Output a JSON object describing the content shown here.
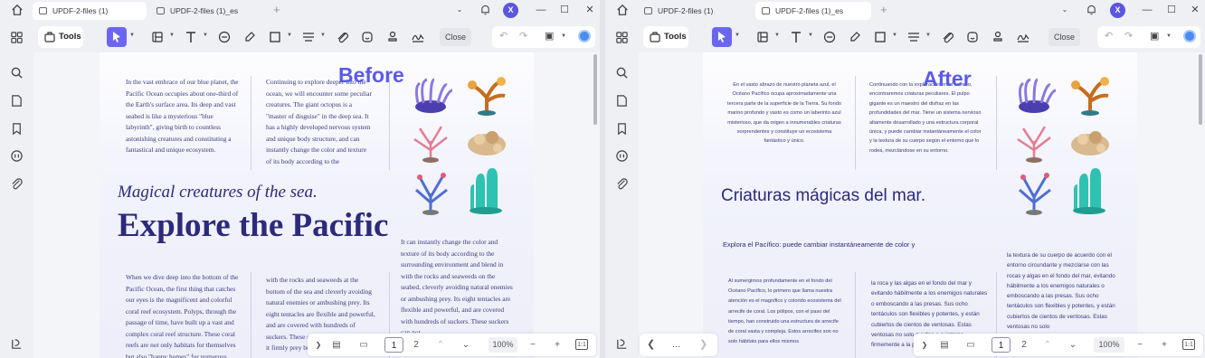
{
  "left": {
    "tabs": [
      {
        "label": "UPDF-2-files (1)"
      },
      {
        "label": "UPDF-2-files (1)_es"
      }
    ],
    "toolbar": {
      "tools_label": "Tools",
      "close_label": "Close"
    },
    "badge": "Before",
    "doc": {
      "col1": "In the vast embrace of our blue planet, the Pacific Ocean occupies about one-third of the Earth's surface area. Its deep and vast seabed is like a mysterious \"blue labyrinth\", giving birth to countless astonishing creatures and constituting a fantastical and unique ecosystem.",
      "col2": "Continuing to explore deeper into the ocean, we will encounter some peculiar creatures. The giant octopus is a \"master of disguise\" in the deep sea. It has a highly developed nervous system and unique body structure, and can instantly change the color and texture of its body according to the surrounding environment, blending is",
      "subtitle": "Magical creatures of the sea.",
      "title": "Explore the Pacific",
      "col3": "It can instantly change the color and texture of its body according to the surrounding environment and blend in with the rocks and seaweeds on the seabed, cleverly avoiding natural enemies or ambushing prey. Its eight tentacles are flexible and powerful, and are covered with hundreds of suckers. These suckers can not",
      "col4": "When we dive deep into the bottom of the Pacific Ocean, the first thing that catches our eyes is the magnificent and colorful coral reef ecosystem. Polyps, through the passage of time, have built up a vast and complex coral reef structure. These coral reefs are not only habitats for themselves but also \"happy homes\" for numerous",
      "col5": "with the rocks and seaweeds at the bottom of the sea and cleverly avoiding natural enemies or ambushing prey. Its eight tentacles are flexible and powerful, and are covered with hundreds of suckers. These suckers can not only help it firmly prey but also be used"
    },
    "pager": {
      "page1": "1",
      "page2": "2",
      "zoom": "100%",
      "fit": "1:1"
    }
  },
  "right": {
    "tabs": [
      {
        "label": "UPDF-2-files (1)"
      },
      {
        "label": "UPDF-2-files (1)_es"
      }
    ],
    "toolbar": {
      "tools_label": "Tools",
      "close_label": "Close"
    },
    "badge": "After",
    "doc": {
      "col1": "En el vasto abrazo de nuestro planeta azul, el Océano Pacífico ocupa aproximadamente una tercera parte de la superficie de la Tierra. Su fondo marino profundo y vasto es como un laberinto azul misterioso, que da origen a innumerables criaturas sorprendentes y constituye un ecosistema fantástico y único.",
      "col2": "Continuando con la exploración en el océano, encontraremos criaturas peculiares. El pulpo gigante es un maestro del disfraz en las profundidades del mar. Tiene un sistema nervioso altamente desarrollado y una estructura corporal única, y puede cambiar instantáneamente el color y la textura de su cuerpo según el entorno que lo rodea, mezclándose en su entorno.",
      "title": "Criaturas mágicas del mar.",
      "explore": "Explora el Pacífico: puede cambiar instantáneamente de color y",
      "col3": "la textura de su cuerpo de acuerdo con el entorno circundante y mezclarse con las rocas y algas en el fondo del mar, evitando hábilmente a los enemigos naturales o emboscando a las presas. Sus ocho tentáculos son flexibles y potentes, y están cubiertos de cientos de ventosas. Estas ventosas no solo",
      "col4": "Al sumergirnos profundamente en el fondo del Océano Pacífico, lo primero que llama nuestra atención es el magnífico y colorido ecosistema del arrecife de coral. Los pólipos, con el paso del tiempo, han construido una estructura de arrecife de coral vasta y compleja. Estos arrecifes son no solo hábitats para ellos mismos",
      "col5": "la roca y las algas en el fondo del mar y evitando hábilmente a los enemigos naturales o emboscando a las presas. Sus ocho tentáculos son flexibles y potentes, y están cubiertos de cientos de ventosas. Estas ventosas no solo ayudan a sujetarse firmemente a la presa"
    },
    "pager": {
      "page1": "1",
      "page2": "2",
      "zoom": "100%",
      "fit": "1:1",
      "dots": "..."
    }
  },
  "user_initial": "X",
  "accent_color": "#6b66f2",
  "title_color": "#2c2a7a"
}
